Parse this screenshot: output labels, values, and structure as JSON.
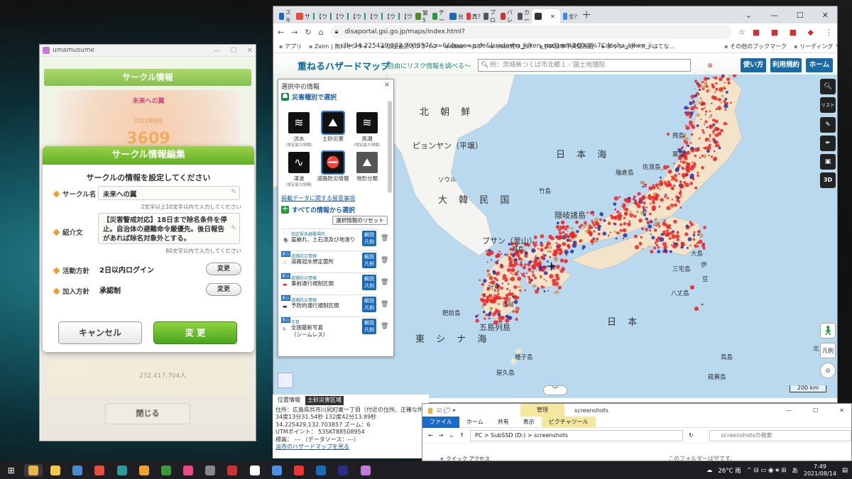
{
  "game": {
    "window_title": "umamusume",
    "bg_header": "サークル情報",
    "bg_circle_name": "未来への翼",
    "bg_date": "2021年8月",
    "bg_number": "3609",
    "modal_title": "サークル情報編集",
    "modal_subtitle": "サークルの情報を設定してください",
    "name_label": "サークル名",
    "name_value": "未来への翼",
    "name_hint": "2文字以上10文字以内で入力してください",
    "intro_label": "紹介文",
    "intro_value": "【災害警戒対応】18日まで除名条件を停止。自治体の避難命令厳優先。後日報告があれば除名対象外とする。",
    "intro_hint": "60文字以内で入力してください",
    "policy_label": "活動方針",
    "policy_value": "2日以内ログイン",
    "policy_button": "変更",
    "join_label": "加入方針",
    "join_value": "承認制",
    "join_button": "変更",
    "cancel_button": "キャンセル",
    "ok_button": "変 更",
    "close_button": "閉じる",
    "bg_row_text": "232,417,704人"
  },
  "browser": {
    "tabs": [
      "スキ",
      "サ",
      "【ウ",
      "【ウ",
      "【ウ",
      "【ウ",
      "【ウ",
      "【ウ",
      "第5",
      "チー",
      "台",
      "真?",
      "プロ",
      "バレ",
      "カー",
      "",
      "全?"
    ],
    "url": "disaportal.gsi.go.jp/maps/index.html?ll=34.225429,132.703857&z=6&base=pale&ls=dosha_kiken_nadare%2C0.8%7Cdosha_kiken_ji...",
    "bookmarks": [
      "アプリ",
      "Zaim | 無料オンライ...",
      "弥生会計オンライン",
      "Uber ヘルプ",
      "Uber売り上げ",
      "JRA日本中央競馬会",
      "ダッシュボード - はてな...",
      "その他のブックマーク",
      "リーディング リスト"
    ],
    "site_title": "重ねるハザードマップ",
    "site_sub": "～自由にリスク情報を調べる～",
    "search_placeholder": "例：茨城県つくば市北郷１／国土地理院",
    "btn_howto": "使い方",
    "btn_terms": "利用規約",
    "btn_home": "ホーム"
  },
  "panel": {
    "title": "選択中の情報",
    "disaster_section": "災害種別で選択",
    "icons": [
      {
        "label": "洪水",
        "sub": "(想定最大規模)"
      },
      {
        "label": "土砂災害",
        "sub": ""
      },
      {
        "label": "高潮",
        "sub": "(想定最大規模)"
      },
      {
        "label": "津波",
        "sub": "(想定最大規模)"
      },
      {
        "label": "道路防災情報",
        "sub": ""
      },
      {
        "label": "地形分類",
        "sub": ""
      }
    ],
    "notice_link": "掲載データに関する留意事項",
    "all_section": "すべての情報から選択",
    "reset_button": "選択情報のリセット",
    "explain": "解説\n凡例",
    "show": "表示",
    "layers": [
      {
        "category": "指定緊急避難場所",
        "name": "崖崩れ、土石流及び地滑り"
      },
      {
        "category": "道路防災情報",
        "name": "道路冠水想定箇所"
      },
      {
        "category": "道路防災情報",
        "name": "事前通行規制区間"
      },
      {
        "category": "道路防災情報",
        "name": "予防的通行規制区間"
      },
      {
        "category": "写真",
        "name": "全国最新写真\n（シームレス）"
      }
    ]
  },
  "map": {
    "labels": [
      "北 朝 鮮",
      "ピョンヤン（平壌）",
      "日 本 海",
      "ソウル",
      "大 韓 民 国",
      "竹島",
      "隠岐諸島",
      "佐渡島",
      "飛島",
      "粟島",
      "舳倉島",
      "プサン（釜山）",
      "見島",
      "対馬",
      "壱岐",
      "五島列島",
      "肥前島",
      "東 シ ナ 海",
      "日 本",
      "種子島",
      "屋久島",
      "大島",
      "三宅島",
      "八丈島",
      "伊",
      "豆",
      "鳥島",
      "北",
      "硫黄島"
    ],
    "scale": "200 km",
    "tab_location": "位置情報",
    "tab_landslide": "土砂災害区域"
  },
  "info": {
    "address": "住所：広島県呉市川尻町東一丁目（付近の住所、正確な所属）",
    "dms": "34度13分31.54秒 132度42分13.89秒",
    "decimal": "34.225429,132.703857 ズーム：6",
    "utm": "UTMポイント： 53SKT88508954",
    "elev": "標高： --- （データソース：---）",
    "link": "当市のハザードマップを見る"
  },
  "explorer": {
    "tools_tab": "管理",
    "title": "screenshots",
    "ribbon": [
      "ファイル",
      "ホーム",
      "共有",
      "表示",
      "ピクチャツール"
    ],
    "path": "PC  >  SubSSD (D:)  >  screenshots",
    "search_placeholder": "screenshotsの検索",
    "empty": "このフォルダーは空です。",
    "quick": "クイック アクセス"
  },
  "taskbar": {
    "weather": "26°C 雨",
    "time": "7:49",
    "date": "2021/08/14",
    "ime": "あ"
  }
}
